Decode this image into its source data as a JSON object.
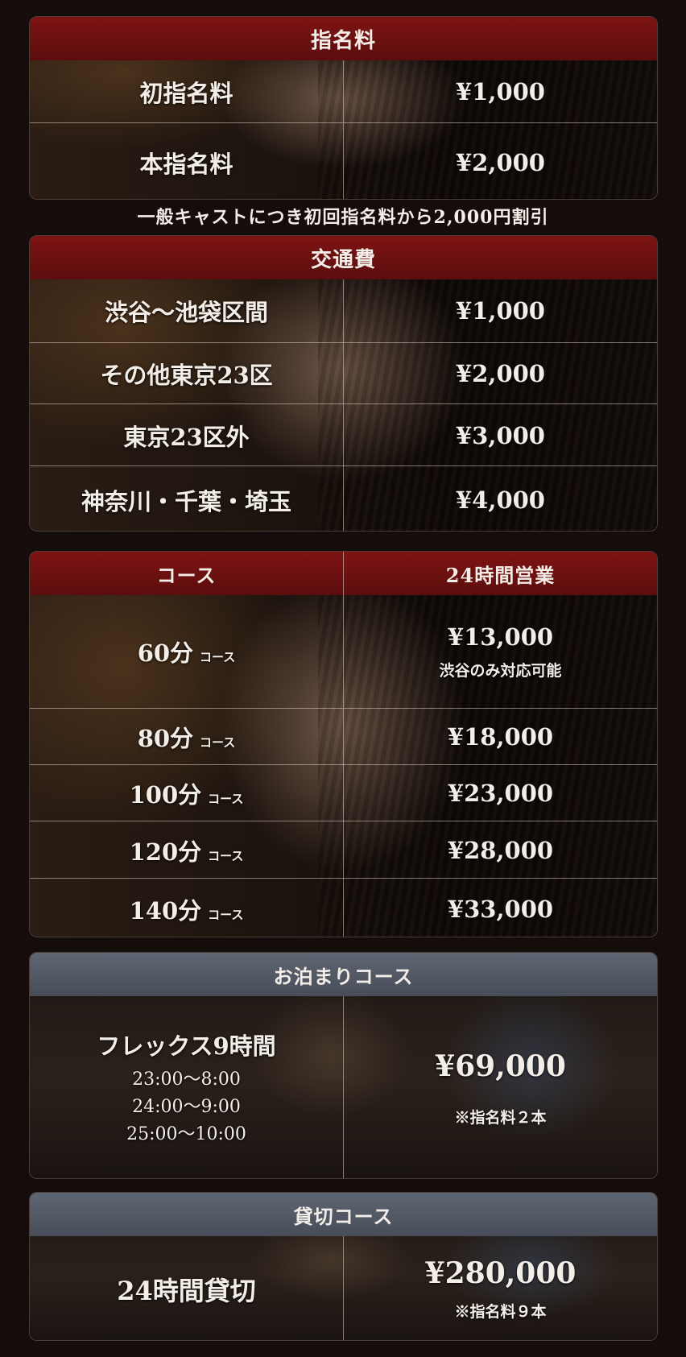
{
  "designation": {
    "header": "指名料",
    "rows": [
      {
        "label": "初指名料",
        "price": "¥1,000"
      },
      {
        "label": "本指名料",
        "price": "¥2,000"
      }
    ],
    "caption": "一般キャストにつき初回指名料から2,000円割引"
  },
  "transport": {
    "header": "交通費",
    "rows": [
      {
        "label": "渋谷〜池袋区間",
        "price": "¥1,000"
      },
      {
        "label": "その他東京23区",
        "price": "¥2,000"
      },
      {
        "label": "東京23区外",
        "price": "¥3,000"
      },
      {
        "label": "神奈川・千葉・埼玉",
        "price": "¥4,000"
      }
    ]
  },
  "course": {
    "header_left": "コース",
    "header_right": "24時間営業",
    "suffix": "コース",
    "rows": [
      {
        "label": "60分",
        "price": "¥13,000",
        "note": "渋谷のみ対応可能"
      },
      {
        "label": "80分",
        "price": "¥18,000"
      },
      {
        "label": "100分",
        "price": "¥23,000"
      },
      {
        "label": "120分",
        "price": "¥28,000"
      },
      {
        "label": "140分",
        "price": "¥33,000"
      }
    ]
  },
  "overnight": {
    "header": "お泊まりコース",
    "label": "フレックス9時間",
    "times": [
      "23:00〜8:00",
      "24:00〜9:00",
      "25:00〜10:00"
    ],
    "price": "¥69,000",
    "note": "※指名料２本"
  },
  "charter": {
    "header": "貸切コース",
    "label": "24時間貸切",
    "price": "¥280,000",
    "note": "※指名料９本"
  }
}
